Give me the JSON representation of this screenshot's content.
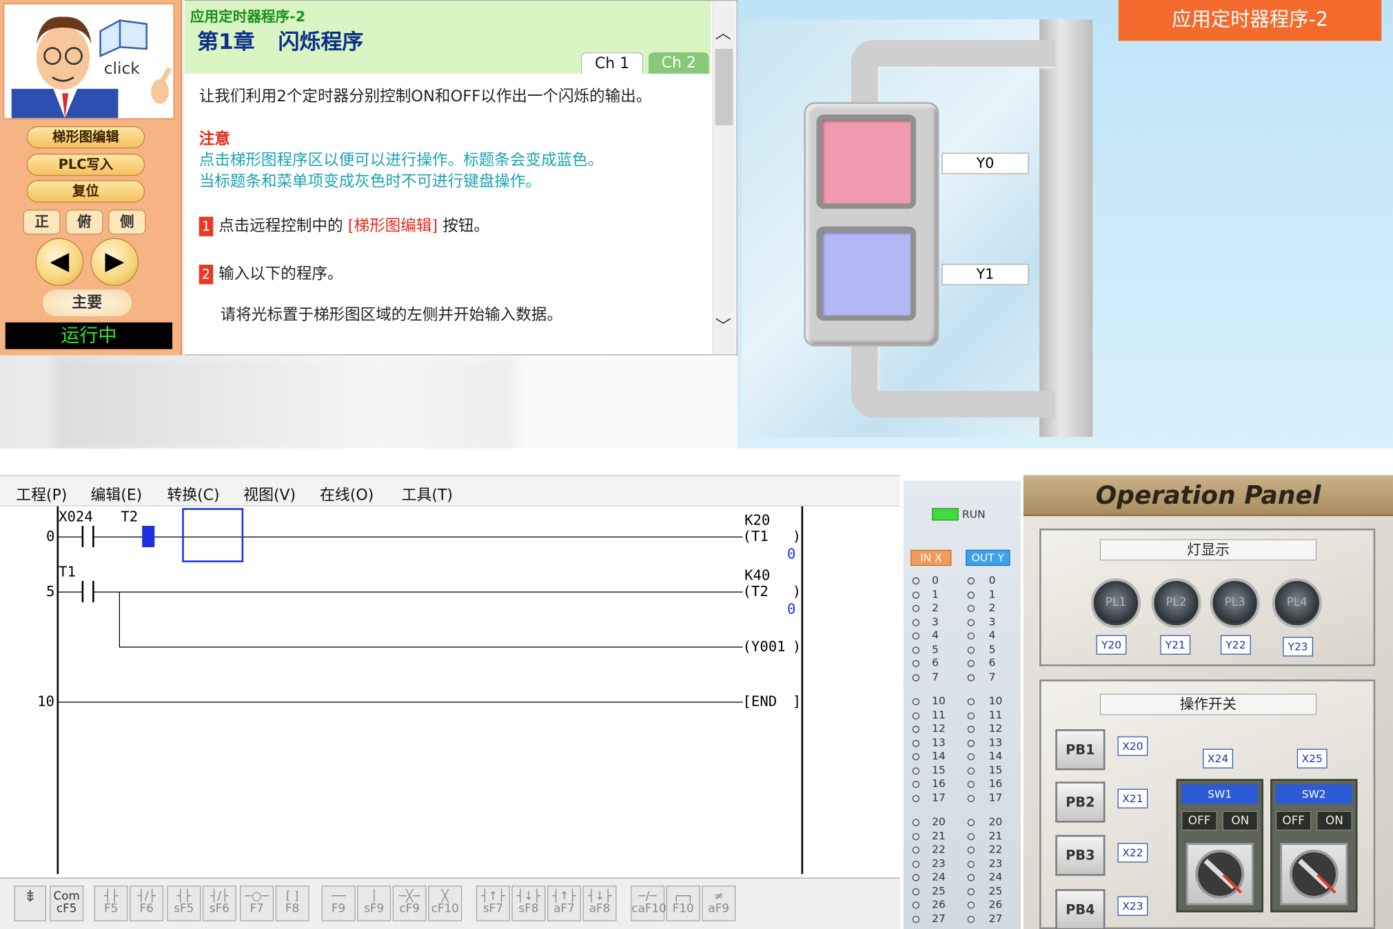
{
  "scene": {
    "title_tag": "应用定时器程序-2",
    "lamp_y0_label": "Y0",
    "lamp_y1_label": "Y1",
    "lamp_y0_color": "#f09bb2",
    "lamp_y1_color": "#b3b8f4"
  },
  "control": {
    "click_label": "click",
    "btn_ladder_edit": "梯形图编辑",
    "btn_plc_write": "PLC写入",
    "btn_reset": "复位",
    "view_front": "正",
    "view_top": "俯",
    "view_side": "侧",
    "prev_label": "◀",
    "next_label": "▶",
    "main_label": "主要",
    "status_text": "运行中"
  },
  "doc": {
    "super_title": "应用定时器程序-2",
    "chapter_title": "第1章 闪烁程序",
    "tab_ch1": "Ch 1",
    "tab_ch2": "Ch 2",
    "intro": "让我们利用2个定时器分别控制ON和OFF以作出一个闪烁的输出。",
    "note_title": "注意",
    "note_line1": "点击梯形图程序区以便可以进行操作。标题条会变成蓝色。",
    "note_line2": "当标题条和菜单项变成灰色时不可进行键盘操作。",
    "step1_num": "1",
    "step1_pre": "点击远程控制中的",
    "step1_highlight": "[梯形图编辑]",
    "step1_post": "按钮。",
    "step2_num": "2",
    "step2_text": "输入以下的程序。",
    "step3_text": "请将光标置于梯形图区域的左侧并开始输入数据。",
    "scroll_up": "︿",
    "scroll_down": "﹀"
  },
  "editor": {
    "menus": [
      "工程(P)",
      "编辑(E)",
      "转换(C)",
      "视图(V)",
      "在线(O)",
      "工具(T)"
    ],
    "rung0_step": "0",
    "rung0_c1": "X024",
    "rung0_c2": "T2",
    "rung0_coil_k": "K20",
    "rung0_coil": "(T1",
    "rung0_val": "0",
    "rung5_step": "5",
    "rung5_c1": "T1",
    "rung5_coil_k": "K40",
    "rung5_coil": "(T2",
    "rung5_val": "0",
    "rung5_coil2": "(Y001",
    "rung10_step": "10",
    "rung10_end": "[END",
    "toolbar": [
      {
        "sym": "┤├",
        "key": "F5"
      },
      {
        "sym": "┤/├",
        "key": "F6"
      },
      {
        "sym": "┤├",
        "key": "sF5"
      },
      {
        "sym": "┤/├",
        "key": "sF6"
      },
      {
        "sym": "─○─",
        "key": "F7"
      },
      {
        "sym": "[ ]",
        "key": "F8"
      },
      {
        "sym": "──",
        "key": "F9"
      },
      {
        "sym": "│",
        "key": "sF9"
      },
      {
        "sym": "─╳─",
        "key": "cF9"
      },
      {
        "sym": "╳",
        "key": "cF10"
      },
      {
        "sym": "┤↑├",
        "key": "sF7"
      },
      {
        "sym": "┤↓├",
        "key": "sF8"
      },
      {
        "sym": "┤↑├",
        "key": "aF7"
      },
      {
        "sym": "┤↓├",
        "key": "aF8"
      },
      {
        "sym": "─/─",
        "key": "caF10"
      },
      {
        "sym": "┌─┐",
        "key": "F10"
      },
      {
        "sym": "≠",
        "key": "aF9"
      }
    ],
    "tb_first_key": "Com",
    "tb_first_sub": "cF5"
  },
  "io": {
    "run_label": "RUN",
    "in_head": "IN X",
    "out_head": "OUT Y",
    "rows": [
      "0",
      "1",
      "2",
      "3",
      "4",
      "5",
      "6",
      "7",
      "",
      "10",
      "11",
      "12",
      "13",
      "14",
      "15",
      "16",
      "17",
      "",
      "20",
      "21",
      "22",
      "23",
      "24",
      "25",
      "26",
      "27"
    ]
  },
  "op": {
    "title": "Operation Panel",
    "lamp_box_title": "灯显示",
    "lamps": [
      {
        "name": "PL1",
        "addr": "Y20"
      },
      {
        "name": "PL2",
        "addr": "Y21"
      },
      {
        "name": "PL3",
        "addr": "Y22"
      },
      {
        "name": "PL4",
        "addr": "Y23"
      }
    ],
    "switch_box_title": "操作开关",
    "buttons": [
      {
        "name": "PB1",
        "addr": "X20"
      },
      {
        "name": "PB2",
        "addr": "X21"
      },
      {
        "name": "PB3",
        "addr": "X22"
      },
      {
        "name": "PB4",
        "addr": "X23"
      }
    ],
    "sw1_addr": "X24",
    "sw2_addr": "X25",
    "sw1_label": "SW1",
    "sw2_label": "SW2",
    "off_label": "OFF",
    "on_label": "ON"
  }
}
